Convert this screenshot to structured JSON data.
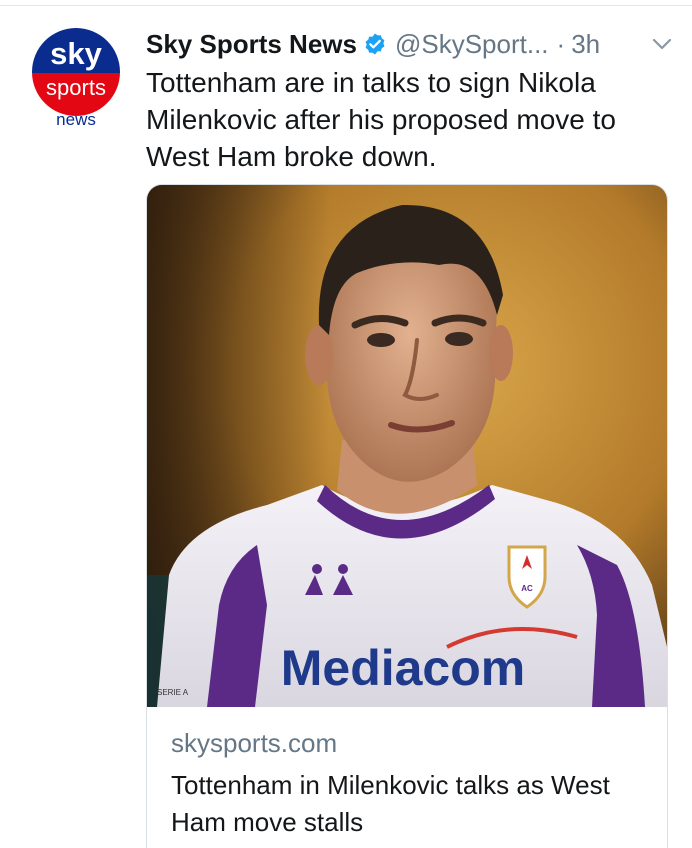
{
  "tweet": {
    "display_name": "Sky Sports News",
    "handle": "@SkySport...",
    "separator": "·",
    "time": "3h",
    "text": "Tottenham are in talks to sign Nikola Milenkovic after his proposed move to West Ham broke down."
  },
  "avatar": {
    "line1": "sky",
    "line2": "sports",
    "line3": "news"
  },
  "card": {
    "domain": "skysports.com",
    "title": "Tottenham in Milenkovic talks as West Ham move stalls",
    "image": {
      "sponsor": "Mediacom",
      "crest_letters": "AC",
      "sleeve_text": "SERIE A"
    }
  },
  "colors": {
    "verified": "#1da1f2",
    "secondary_text": "#657786",
    "sky_blue": "#0a2a8c",
    "sky_red": "#e30613",
    "kit_purple": "#5b2a86"
  },
  "icons": {
    "verified": "verified-badge-icon",
    "more": "chevron-down-icon"
  }
}
